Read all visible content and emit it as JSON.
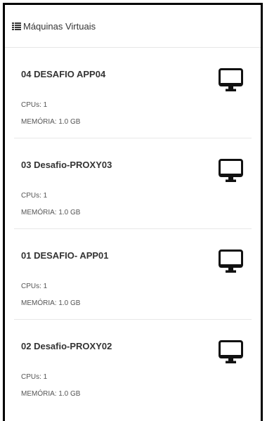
{
  "header": {
    "title": "Máquinas Virtuais",
    "icon": "list-icon"
  },
  "vms": [
    {
      "name": "04 DESAFIO APP04",
      "cpus": "CPUs: 1",
      "memory": "MEMÓRIA: 1.0 GB",
      "icon": "desktop-monitor-icon"
    },
    {
      "name": "03 Desafio-PROXY03",
      "cpus": "CPUs: 1",
      "memory": "MEMÓRIA: 1.0 GB",
      "icon": "desktop-monitor-icon"
    },
    {
      "name": "01 DESAFIO- APP01",
      "cpus": "CPUs: 1",
      "memory": "MEMÓRIA: 1.0 GB",
      "icon": "desktop-monitor-icon"
    },
    {
      "name": "02 Desafio-PROXY02",
      "cpus": "CPUs: 1",
      "memory": "MEMÓRIA: 1.0 GB",
      "icon": "desktop-monitor-icon"
    }
  ],
  "colors": {
    "frame": "#000000",
    "text": "#333333",
    "divider": "#e8e8e8"
  }
}
